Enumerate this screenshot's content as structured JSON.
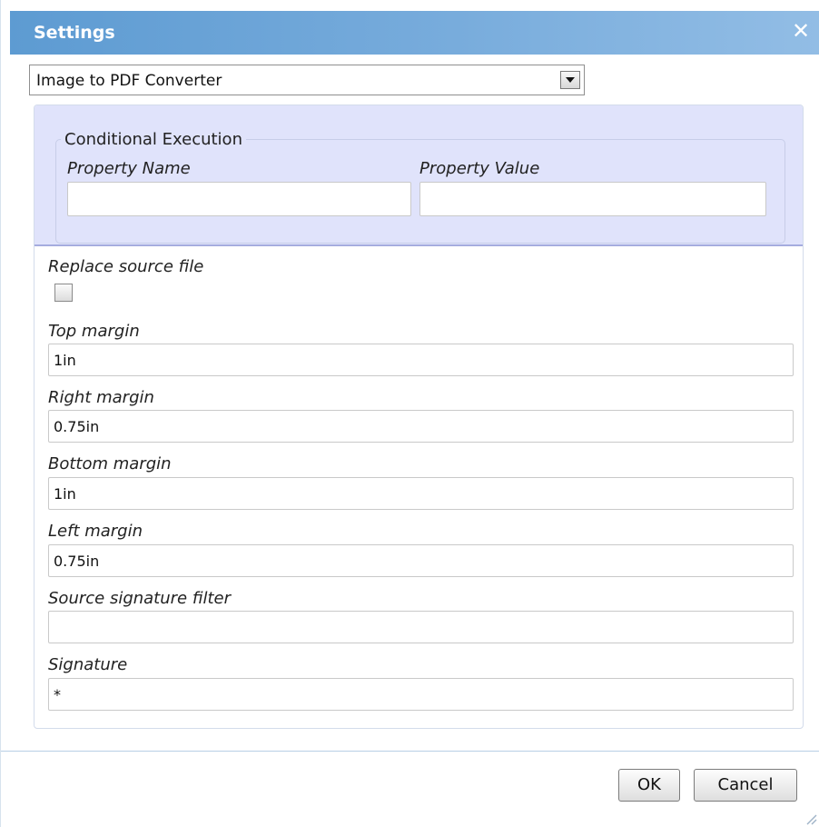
{
  "dialog": {
    "title": "Settings",
    "close_icon": "close-icon",
    "module_select": {
      "selected": "Image to PDF Converter"
    },
    "conditional_execution": {
      "legend": "Conditional Execution",
      "property_name_label": "Property Name",
      "property_name_value": "",
      "property_value_label": "Property Value",
      "property_value_value": ""
    },
    "replace_source": {
      "label": "Replace source file",
      "checked": false
    },
    "top_margin": {
      "label": "Top margin",
      "value": "1in"
    },
    "right_margin": {
      "label": "Right margin",
      "value": "0.75in"
    },
    "bottom_margin": {
      "label": "Bottom margin",
      "value": "1in"
    },
    "left_margin": {
      "label": "Left margin",
      "value": "0.75in"
    },
    "source_signature_filter": {
      "label": "Source signature filter",
      "value": ""
    },
    "signature": {
      "label": "Signature",
      "value": "*"
    },
    "buttons": {
      "ok": "OK",
      "cancel": "Cancel"
    }
  }
}
